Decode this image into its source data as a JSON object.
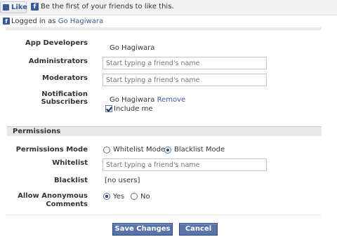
{
  "like_bar": {
    "like_label": "Like",
    "text": "Be the first of your friends to like this."
  },
  "logged_in": {
    "prefix": "Logged in as",
    "user": "Go Hagiwara"
  },
  "form": {
    "app_developers": {
      "label": "App Developers",
      "value": "Go Hagiwara"
    },
    "administrators": {
      "label": "Administrators",
      "placeholder": "Start typing a friend's name"
    },
    "moderators": {
      "label": "Moderators",
      "placeholder": "Start typing a friend's name"
    },
    "notification_subscribers": {
      "label": "Notification Subscribers",
      "user": "Go Hagiwara",
      "remove_label": "Remove",
      "include_me_label": "Include me",
      "include_me_checked": true
    }
  },
  "permissions": {
    "header": "Permissions",
    "mode": {
      "label": "Permissions Mode",
      "options": [
        {
          "label": "Whitelist Mode",
          "selected": false
        },
        {
          "label": "Blacklist Mode",
          "selected": true
        }
      ]
    },
    "whitelist": {
      "label": "Whitelist",
      "placeholder": "Start typing a friend's name"
    },
    "blacklist": {
      "label": "Blacklist",
      "value": "[no users]"
    },
    "anonymous": {
      "label_line1": "Allow Anonymous",
      "label_line2": "Comments",
      "options": [
        {
          "label": "Yes",
          "selected": true
        },
        {
          "label": "No",
          "selected": false
        }
      ]
    }
  },
  "buttons": {
    "save": "Save Changes",
    "cancel": "Cancel"
  },
  "colors": {
    "brand": "#3b5998",
    "button_bg": "#5b74a8",
    "section_bar": "#e8e8e8"
  }
}
